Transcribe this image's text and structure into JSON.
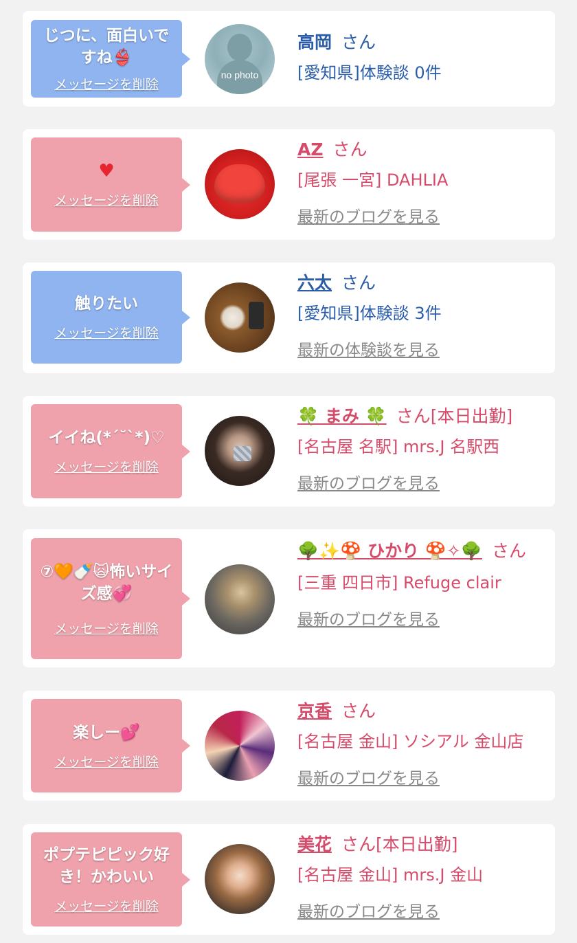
{
  "delete_label": "メッセージを削除",
  "san": "さん",
  "entries": [
    {
      "message": "じつに、面白いですね👙",
      "name": "高岡",
      "san_suffix": "",
      "area": "[愛知県]体験談 0件",
      "link": "",
      "avatar_text": "no photo"
    },
    {
      "message": "♥",
      "name": "AZ",
      "san_suffix": "",
      "area": "[尾張 一宮] DAHLIA",
      "link": "最新のブログを見る"
    },
    {
      "message": "触りたい",
      "name": "六太",
      "san_suffix": "",
      "area": "[愛知県]体験談 3件",
      "link": "最新の体験談を見る"
    },
    {
      "message": "イイね(*´˘`*)♡",
      "name": "🍀 まみ 🍀",
      "san_suffix": "[本日出勤]",
      "area": "[名古屋 名駅] mrs.J 名駅西",
      "link": "最新のブログを見る"
    },
    {
      "message": "⑦🧡🍼🙀怖いサイズ感💞",
      "name": "🌳✨🍄 ひかり 🍄✧🌳",
      "san_suffix": "",
      "area": "[三重 四日市] Refuge clair",
      "link": "最新のブログを見る"
    },
    {
      "message": "楽しー💕",
      "name": "京香",
      "san_suffix": "",
      "area": "[名古屋 金山] ソシアル 金山店",
      "link": "最新のブログを見る"
    },
    {
      "message": "ポプテピピック好き！かわいい",
      "name": "美花",
      "san_suffix": "[本日出勤]",
      "area": "[名古屋 金山] mrs.J 金山",
      "link": "最新のブログを見る"
    }
  ]
}
